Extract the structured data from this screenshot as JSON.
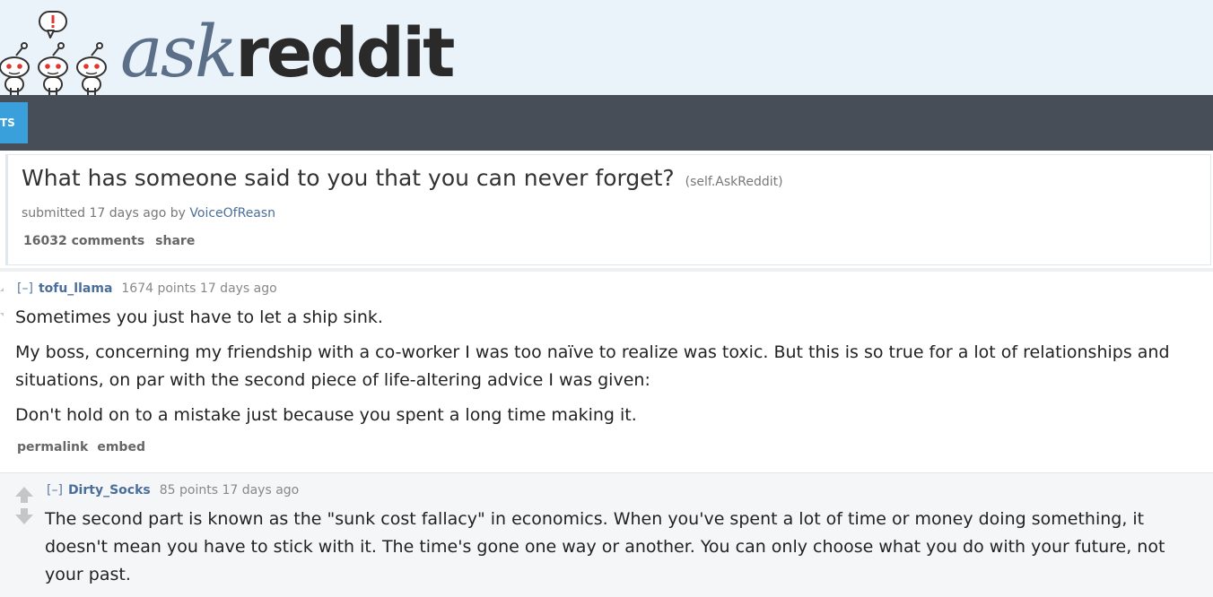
{
  "header": {
    "logo_ask": "ask",
    "logo_reddit": "reddit",
    "nav_tab_label": "TS"
  },
  "post": {
    "title": "What has someone said to you that you can never forget?",
    "domain": "(self.AskReddit)",
    "meta_prefix": "submitted 17 days ago by",
    "author": "VoiceOfReasn",
    "comments_label": "16032 comments",
    "share_label": "share"
  },
  "comments": [
    {
      "toggle": "[–]",
      "author": "tofu_llama",
      "score_time": "1674 points 17 days ago",
      "paragraphs": [
        "Sometimes you just have to let a ship sink.",
        "My boss, concerning my friendship with a co-worker I was too naïve to realize was toxic. But this is so true for a lot of relationships and situations, on par with the second piece of life-altering advice I was given:",
        "Don't hold on to a mistake just because you spent a long time making it."
      ],
      "permalink_label": "permalink",
      "embed_label": "embed"
    },
    {
      "toggle": "[–]",
      "author": "Dirty_Socks",
      "score_time": "85 points 17 days ago",
      "paragraphs": [
        "The second part is known as the \"sunk cost fallacy\" in economics. When you've spent a lot of time or money doing something, it doesn't mean you have to stick with it. The time's gone one way or another. You can only choose what you do with your future, not your past."
      ]
    }
  ],
  "colors": {
    "header_bg": "#eaf2fa",
    "navbar_bg": "#474e58",
    "nav_tab_bg": "#3aa0dc",
    "link_blue": "#4a6e9a"
  }
}
